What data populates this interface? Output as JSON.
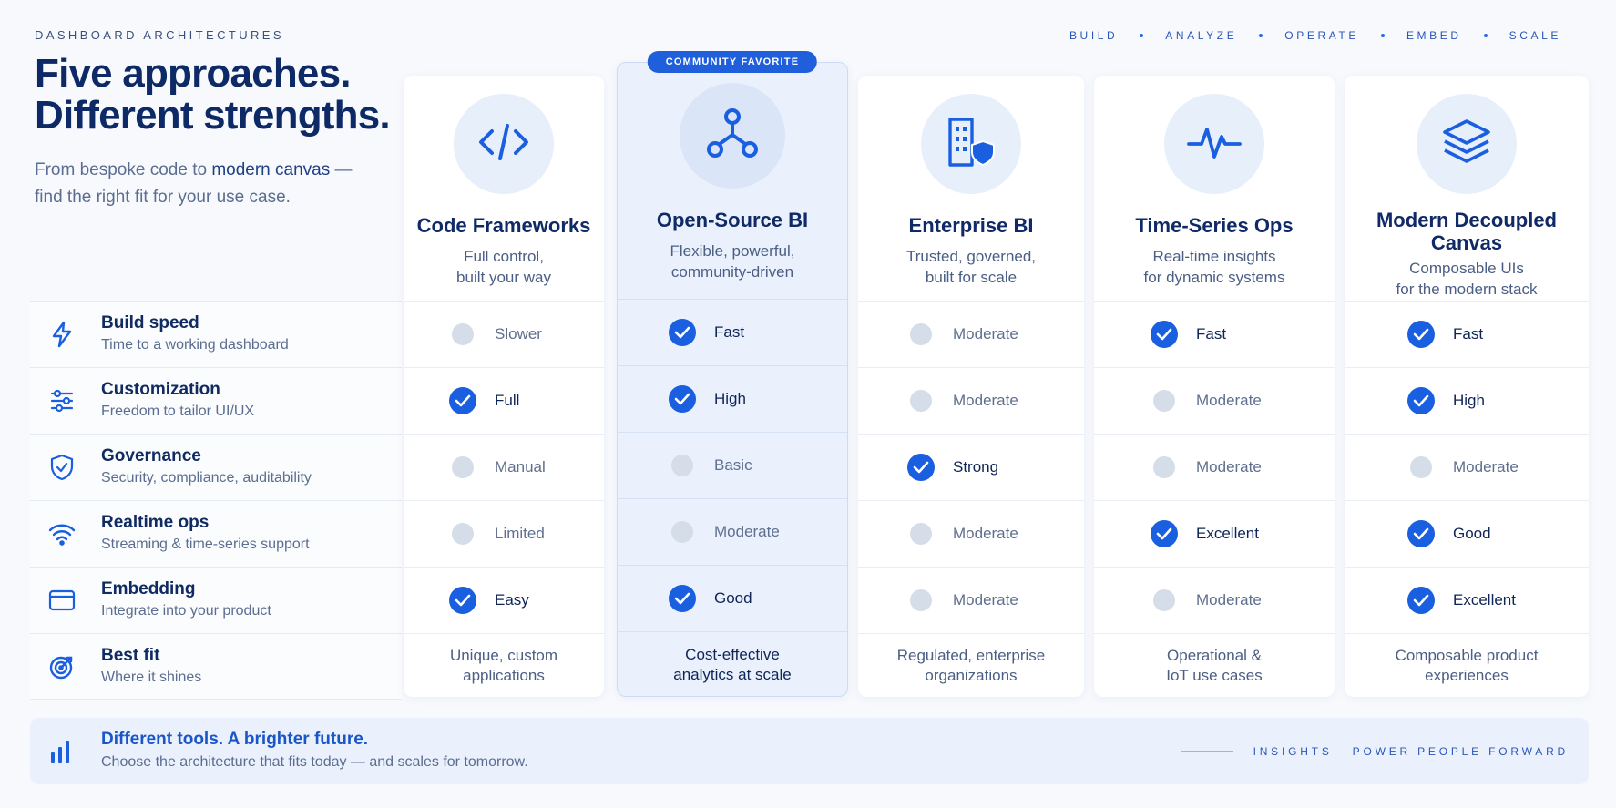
{
  "eyebrow": "DASHBOARD ARCHITECTURES",
  "nav": [
    "BUILD",
    "ANALYZE",
    "OPERATE",
    "EMBED",
    "SCALE"
  ],
  "headline": [
    "Five approaches.",
    "Different strengths."
  ],
  "subhead": {
    "pre": "From bespoke code to ",
    "em": "modern canvas",
    "post": " — find the right fit for your use case."
  },
  "rows": [
    {
      "title": "Build speed",
      "desc": "Time to a working dashboard",
      "icon": "lightning-icon"
    },
    {
      "title": "Customization",
      "desc": "Freedom to tailor UI/UX",
      "icon": "sliders-icon"
    },
    {
      "title": "Governance",
      "desc": "Security, compliance, auditability",
      "icon": "shield-check-icon"
    },
    {
      "title": "Realtime ops",
      "desc": "Streaming & time-series support",
      "icon": "wifi-icon"
    },
    {
      "title": "Embedding",
      "desc": "Integrate into your product",
      "icon": "browser-window-icon"
    },
    {
      "title": "Best fit",
      "desc": "Where it shines",
      "icon": "target-icon"
    }
  ],
  "columns": [
    {
      "title": "Code Frameworks",
      "sub": [
        "Full control,",
        "built your way"
      ],
      "icon": "code-icon",
      "cells": [
        {
          "v": "Slower",
          "on": false
        },
        {
          "v": "Full",
          "on": true
        },
        {
          "v": "Manual",
          "on": false
        },
        {
          "v": "Limited",
          "on": false
        },
        {
          "v": "Easy",
          "on": true
        }
      ],
      "fit": [
        "Unique, custom",
        "applications"
      ]
    },
    {
      "title": "Open-Source BI",
      "sub": [
        "Flexible, powerful,",
        "community-driven"
      ],
      "icon": "share-nodes-icon",
      "badge": "COMMUNITY FAVORITE",
      "cells": [
        {
          "v": "Fast",
          "on": true
        },
        {
          "v": "High",
          "on": true
        },
        {
          "v": "Basic",
          "on": false
        },
        {
          "v": "Moderate",
          "on": false
        },
        {
          "v": "Good",
          "on": true
        }
      ],
      "fit": [
        "Cost-effective",
        "analytics at scale"
      ]
    },
    {
      "title": "Enterprise BI",
      "sub": [
        "Trusted, governed,",
        "built for scale"
      ],
      "icon": "building-shield-icon",
      "cells": [
        {
          "v": "Moderate",
          "on": false
        },
        {
          "v": "Moderate",
          "on": false
        },
        {
          "v": "Strong",
          "on": true
        },
        {
          "v": "Moderate",
          "on": false
        },
        {
          "v": "Moderate",
          "on": false
        }
      ],
      "fit": [
        "Regulated, enterprise",
        "organizations"
      ]
    },
    {
      "title": "Time-Series Ops",
      "sub": [
        "Real-time insights",
        "for dynamic systems"
      ],
      "icon": "pulse-icon",
      "cells": [
        {
          "v": "Fast",
          "on": true
        },
        {
          "v": "Moderate",
          "on": false
        },
        {
          "v": "Moderate",
          "on": false
        },
        {
          "v": "Excellent",
          "on": true
        },
        {
          "v": "Moderate",
          "on": false
        }
      ],
      "fit": [
        "Operational &",
        "IoT use cases"
      ]
    },
    {
      "title": "Modern Decoupled Canvas",
      "sub": [
        "Composable UIs",
        "for the modern stack"
      ],
      "icon": "layers-icon",
      "cells": [
        {
          "v": "Fast",
          "on": true
        },
        {
          "v": "High",
          "on": true
        },
        {
          "v": "Moderate",
          "on": false
        },
        {
          "v": "Good",
          "on": true
        },
        {
          "v": "Excellent",
          "on": true
        }
      ],
      "fit": [
        "Composable product",
        "experiences"
      ]
    }
  ],
  "footer": {
    "title": "Different tools. A brighter future.",
    "desc": "Choose the architecture that fits today — and scales for tomorrow.",
    "right": [
      "INSIGHTS",
      "POWER PEOPLE FORWARD"
    ]
  },
  "colors": {
    "accent": "#1a5fe0",
    "navy": "#0f2a66",
    "muted": "#5b6d90"
  }
}
